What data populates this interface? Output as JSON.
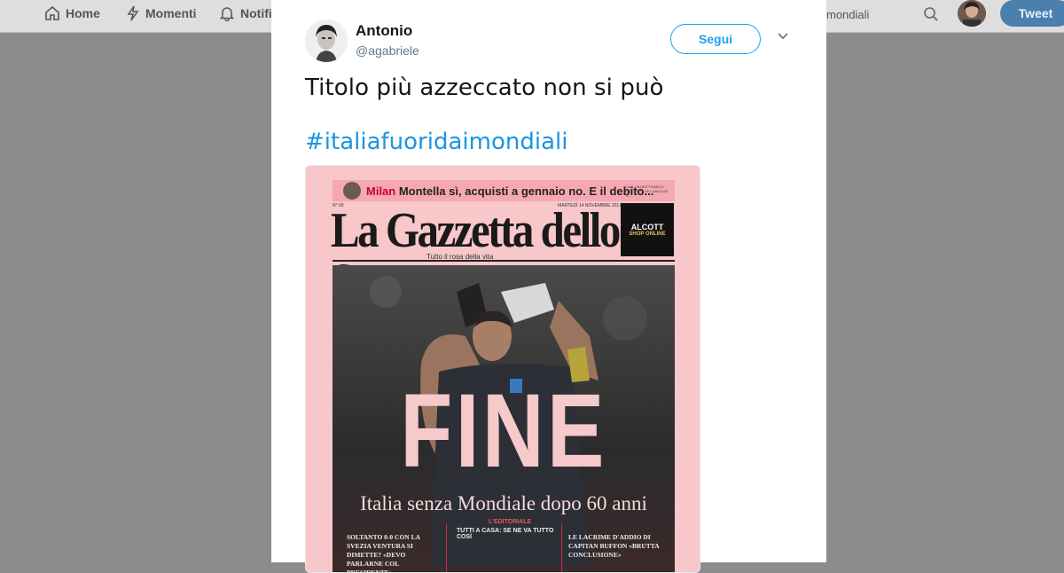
{
  "topbar": {
    "nav": [
      {
        "label": "Home",
        "icon": "home-icon"
      },
      {
        "label": "Momenti",
        "icon": "lightning-icon"
      },
      {
        "label": "Notifi",
        "icon": "bell-icon"
      }
    ],
    "search_value": "mondiali",
    "tweet_button": "Tweet"
  },
  "tweet": {
    "author_name": "Antonio",
    "author_handle": "@agabriele",
    "follow_label": "Segui",
    "text": "Titolo più azzeccato non si può",
    "hashtag": "#italiafuoridaimondiali"
  },
  "newspaper": {
    "top_strip_kw": "Milan",
    "top_strip": " Montella sì, acquisti a gennaio no. E il debito...",
    "top_strip_small": "L'ALL. BLUES FRANCO VIA... RETA DEL NIKOLAS TL...",
    "date_left": "N° 00",
    "date_right": "MARTEDÌ 14 NOVEMBRE 2017",
    "masthead": "La Gazzetta dello Sport",
    "tagline": "Tutto il rosa della vita",
    "ad_title": "ALCOTT",
    "ad_sub": "SHOP ONLINE",
    "headline": "FINE",
    "subheadline": "Italia senza Mondiale dopo 60 anni",
    "editorial_label": "L'EDITORIALE",
    "center_head": "TUTTI A CASA: SE NE VA TUTTO COSÌ",
    "col_left": "SOLTANTO 0-0 CON LA SVEZIA VENTURA SI DIMETTE? «DEVO PARLARNE COL PRESIDENTE»",
    "col_right": "LE LACRIME D'ADDIO DI CAPITAN BUFFON «BRUTTA CONCLUSIONE»"
  },
  "colors": {
    "accent": "#1da1f2",
    "hashtag": "#1b95e0",
    "overlay": "#8c8c8c",
    "newspaper_pink": "#f7c7c9"
  }
}
